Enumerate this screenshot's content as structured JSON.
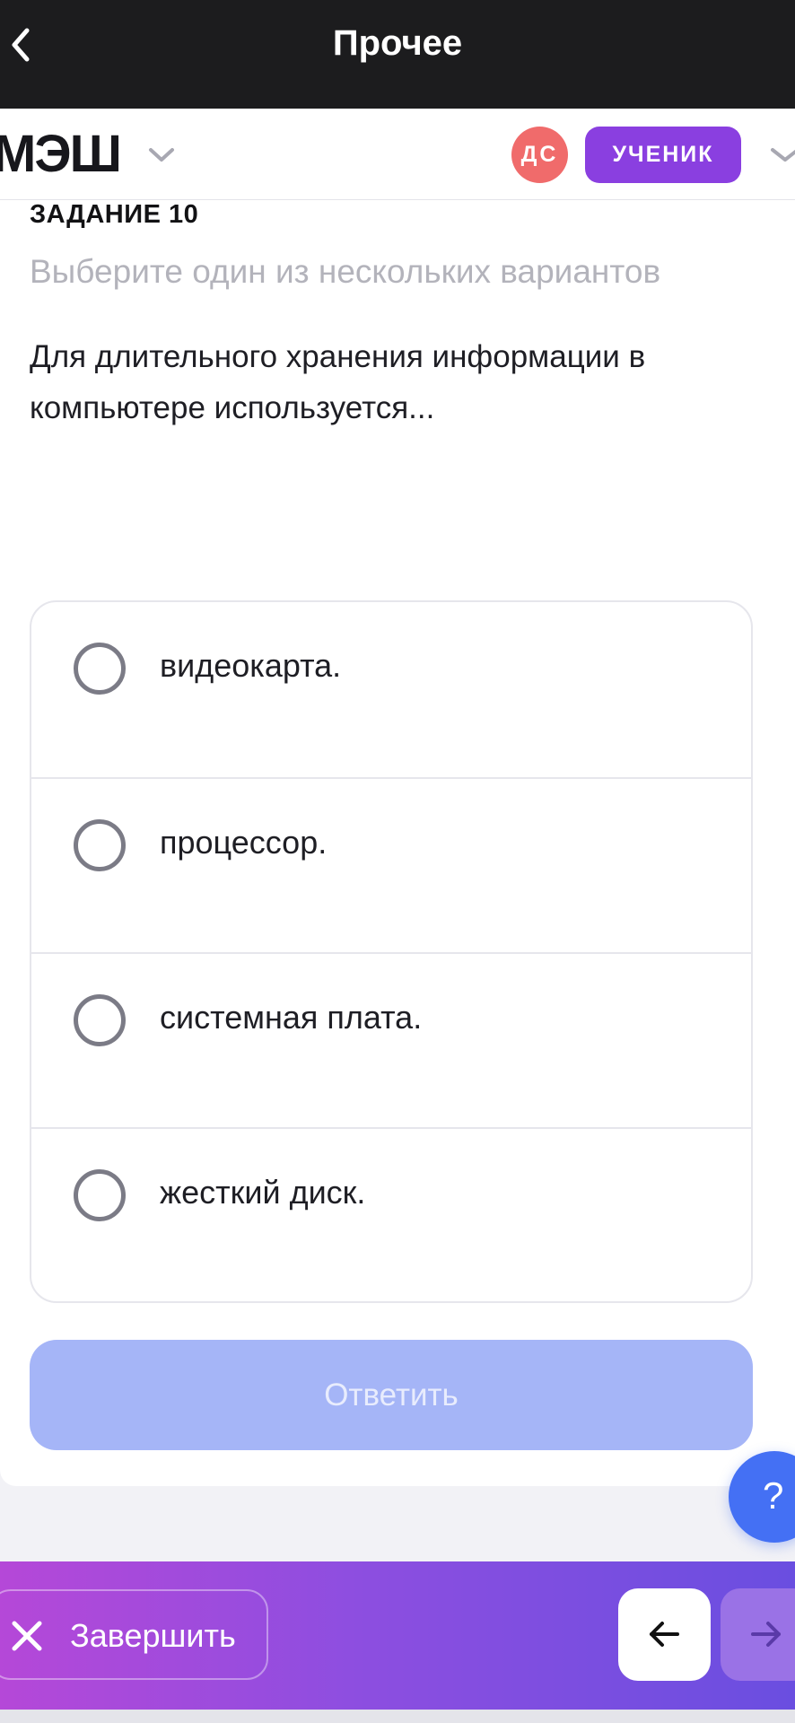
{
  "topbar": {
    "title": "Прочее"
  },
  "header": {
    "logo": "МЭШ",
    "avatar_initials": "ДС",
    "role": "УЧЕНИК"
  },
  "task": {
    "title": "ЗАДАНИЕ 10",
    "hint": "Выберите один из нескольких вариантов",
    "question": "Для длительного хранения информации в компьютере используется..."
  },
  "options": [
    {
      "label": "видеокарта."
    },
    {
      "label": "процессор."
    },
    {
      "label": "системная плата."
    },
    {
      "label": "жесткий диск."
    }
  ],
  "submit_label": "Ответить",
  "help_label": "?",
  "footer": {
    "finish_label": "Завершить"
  },
  "colors": {
    "topbar": "#1c1c1e",
    "avatar": "#f06b6b",
    "role_badge": "#8a3fe0",
    "submit_disabled": "#a5b5f7",
    "help": "#4470f4",
    "footer_gradient_start": "#b548d8",
    "footer_gradient_end": "#6a4ee0"
  }
}
